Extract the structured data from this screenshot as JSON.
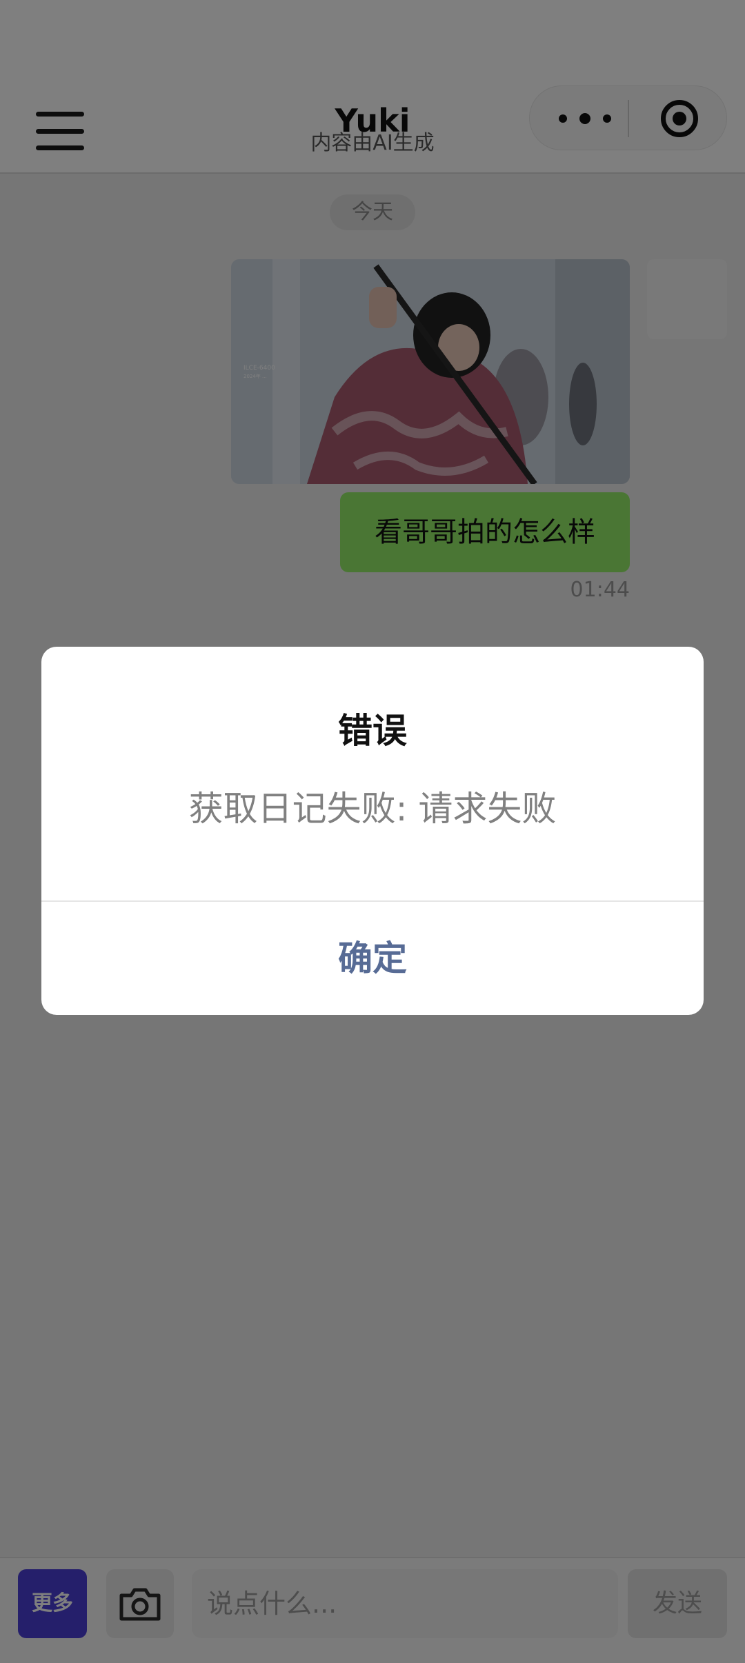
{
  "header": {
    "title": "Yuki",
    "subtitle": "内容由AI生成"
  },
  "chat": {
    "date_label": "今天",
    "message_text": "看哥哥拍的怎么样",
    "message_time": "01:44"
  },
  "input_bar": {
    "more_label": "更多",
    "placeholder": "说点什么...",
    "send_label": "发送"
  },
  "dialog": {
    "title": "错误",
    "message": "获取日记失败: 请求失败",
    "confirm_label": "确定"
  },
  "colors": {
    "accent_button": "#4a3fd6",
    "sent_bubble": "#95ec69",
    "dialog_confirm": "#576b95"
  }
}
